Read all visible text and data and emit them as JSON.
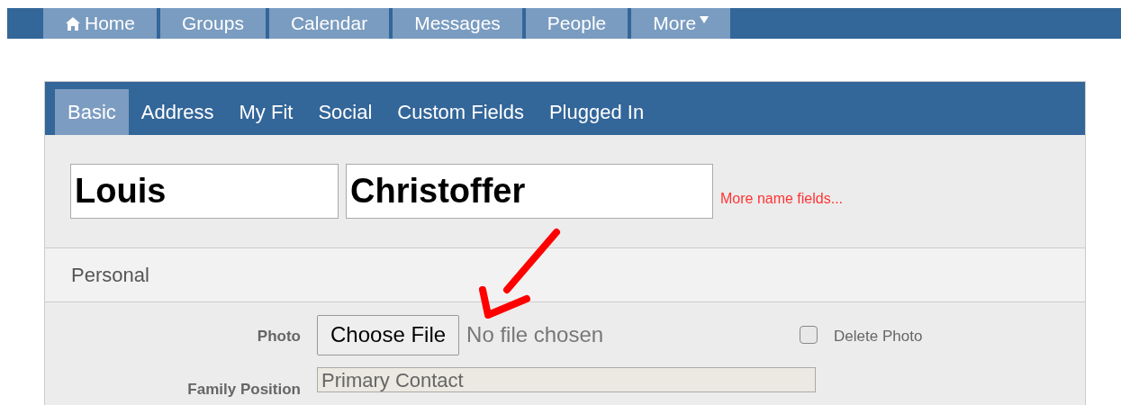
{
  "top_nav": [
    {
      "label": "Home",
      "kind": "home",
      "selected": false
    },
    {
      "label": "Groups",
      "kind": "plain",
      "selected": false
    },
    {
      "label": "Calendar",
      "kind": "plain",
      "selected": false
    },
    {
      "label": "Messages",
      "kind": "plain",
      "selected": false
    },
    {
      "label": "People",
      "kind": "plain",
      "selected": false
    },
    {
      "label": "More",
      "kind": "dropdown",
      "selected": false
    }
  ],
  "tabs": [
    {
      "label": "Basic",
      "selected": true
    },
    {
      "label": "Address",
      "selected": false
    },
    {
      "label": "My Fit",
      "selected": false
    },
    {
      "label": "Social",
      "selected": false
    },
    {
      "label": "Custom Fields",
      "selected": false
    },
    {
      "label": "Plugged In",
      "selected": false
    }
  ],
  "name": {
    "first": "Louis",
    "last": "Christoffer",
    "more_link": "More name fields..."
  },
  "section": {
    "title": "Personal"
  },
  "photo": {
    "label": "Photo",
    "button": "Choose File",
    "status": "No file chosen",
    "delete_label": "Delete Photo",
    "delete_checked": false
  },
  "family_position": {
    "label": "Family Position",
    "value": "Primary Contact"
  }
}
